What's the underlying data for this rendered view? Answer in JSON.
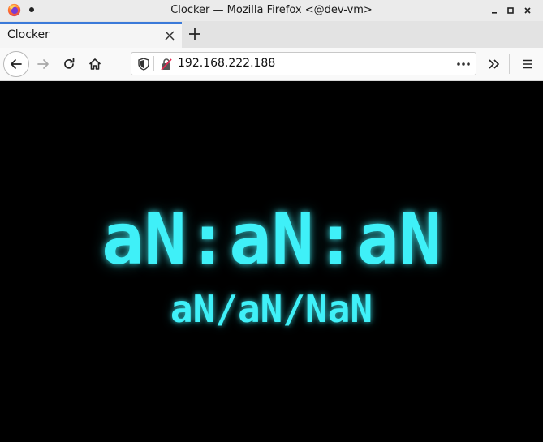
{
  "window": {
    "title": "Clocker — Mozilla Firefox <@dev-vm>"
  },
  "tabs": [
    {
      "label": "Clocker"
    }
  ],
  "navbar": {
    "url": "192.168.222.188"
  },
  "clock": {
    "time": "aN:aN:aN",
    "date": "aN/aN/NaN",
    "color": "#3ff0f8"
  },
  "icons": {
    "logo": "firefox-logo-icon",
    "back": "arrow-left-icon",
    "forward": "arrow-right-icon",
    "reload": "reload-icon",
    "home": "home-icon",
    "tracking": "shield-icon",
    "insecure": "insecure-lock-icon",
    "page_actions": "ellipsis-icon",
    "overflow": "chevrons-right-icon",
    "menu": "hamburger-menu-icon"
  }
}
